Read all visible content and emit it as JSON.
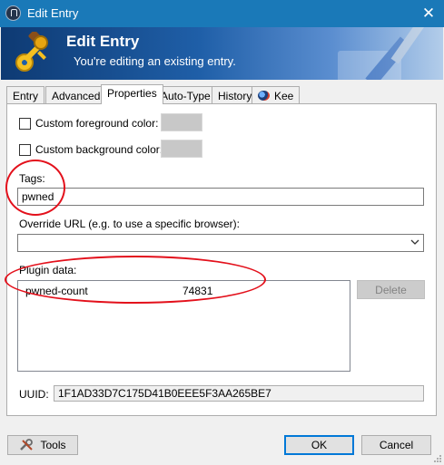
{
  "window": {
    "title": "Edit Entry",
    "close_glyph": "✕",
    "icon": "lock-icon"
  },
  "banner": {
    "title": "Edit Entry",
    "subtitle": "You're editing an existing entry.",
    "icon": "keys-icon"
  },
  "tabs": [
    {
      "label": "Entry",
      "active": false
    },
    {
      "label": "Advanced",
      "active": false
    },
    {
      "label": "Properties",
      "active": true
    },
    {
      "label": "Auto-Type",
      "active": false
    },
    {
      "label": "History",
      "active": false
    },
    {
      "label": "Kee",
      "active": false,
      "icon": "kee-globe-icon"
    }
  ],
  "properties": {
    "fg_color_label": "Custom foreground color:",
    "bg_color_label": "Custom background color:",
    "tags_label": "Tags:",
    "tags_value": "pwned",
    "override_url_label": "Override URL (e.g. to use a specific browser):",
    "override_url_value": "",
    "plugin_data_label": "Plugin data:",
    "plugin_data": [
      {
        "key": "pwned-count",
        "value": "74831"
      }
    ],
    "delete_label": "Delete",
    "uuid_label": "UUID:",
    "uuid_value": "1F1AD33D7C175D41B0EEE5F3AA265BE7"
  },
  "footer": {
    "tools_label": "Tools",
    "ok_label": "OK",
    "cancel_label": "Cancel"
  },
  "colors": {
    "titlebar": "#1a79b8",
    "default_button_border": "#0078d7",
    "annotation": "#e3101b",
    "swatch": "#c8c8c8"
  }
}
